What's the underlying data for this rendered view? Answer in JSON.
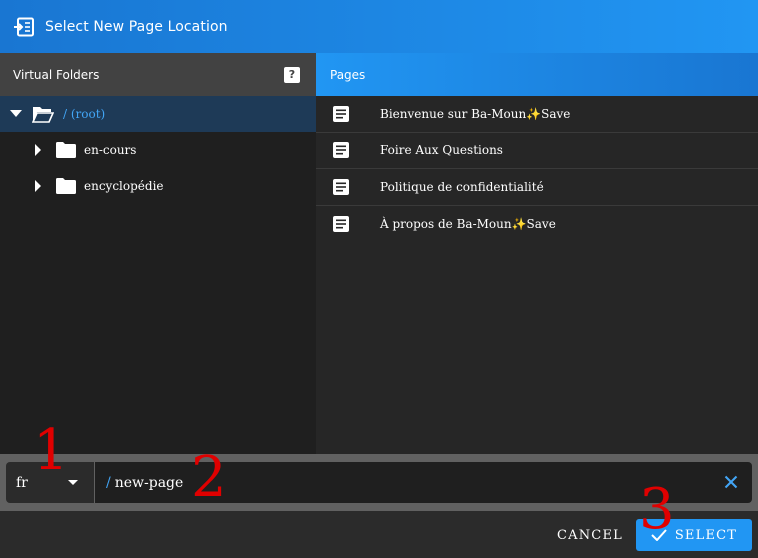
{
  "dialog": {
    "title": "Select New Page Location"
  },
  "folders": {
    "header": "Virtual Folders",
    "help_glyph": "?",
    "root": "/ (root)",
    "items": [
      {
        "label": "en-cours"
      },
      {
        "label": "encyclopédie"
      }
    ]
  },
  "pages": {
    "header": "Pages",
    "items": [
      {
        "title": "Bienvenue sur Ba-Moun✨Save"
      },
      {
        "title": "Foire Aux Questions"
      },
      {
        "title": "Politique de confidentialité"
      },
      {
        "title": "À propos de Ba-Moun✨Save"
      }
    ]
  },
  "path": {
    "locale": "fr",
    "prefix": "/",
    "value": "new-page"
  },
  "actions": {
    "cancel": "CANCEL",
    "select": "SELECT"
  },
  "annotations": [
    "1",
    "2",
    "3"
  ],
  "colors": {
    "accent": "#2196f3",
    "annotation": "#e00000"
  }
}
